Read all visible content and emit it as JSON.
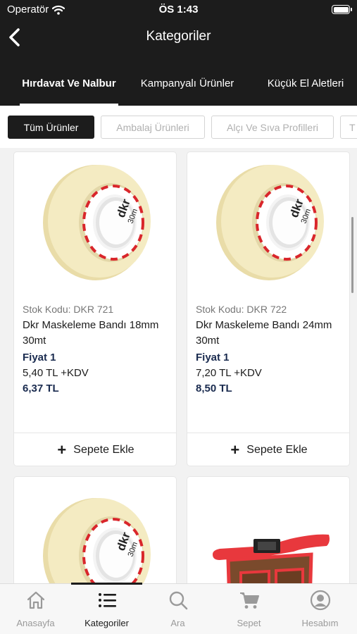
{
  "status_bar": {
    "carrier": "Operatör",
    "time": "ÖS 1:43"
  },
  "header": {
    "title": "Kategoriler"
  },
  "category_tabs": [
    {
      "label": "Hırdavat Ve Nalbur",
      "active": true
    },
    {
      "label": "Kampanyalı Ürünler",
      "active": false
    },
    {
      "label": "Küçük El Aletleri",
      "active": false
    }
  ],
  "filter_chips": [
    {
      "label": "Tüm Ürünler",
      "active": true
    },
    {
      "label": "Ambalaj Ürünleri",
      "active": false
    },
    {
      "label": "Alçı Ve Sıva Profilleri",
      "active": false
    },
    {
      "label": "T",
      "active": false
    }
  ],
  "products": [
    {
      "code": "Stok Kodu: DKR 721",
      "name": "Dkr Maskeleme Bandı 18mm 30mt",
      "price_label": "Fiyat 1",
      "price": "5,40 TL +KDV",
      "total": "6,37 TL",
      "add_label": "Sepete Ekle",
      "image": "tape-image"
    },
    {
      "code": "Stok Kodu: DKR 722",
      "name": "Dkr Maskeleme Bandı 24mm 30mt",
      "price_label": "Fiyat 1",
      "price": "7,20 TL +KDV",
      "total": "8,50 TL",
      "add_label": "Sepete Ekle",
      "image": "tape-image"
    },
    {
      "image": "tape-image"
    },
    {
      "image": "tool-belt-image"
    }
  ],
  "tape_brand": "dkr",
  "tape_length": "30m",
  "bottom_tabs": [
    {
      "label": "Anasayfa",
      "icon": "home-icon",
      "active": false
    },
    {
      "label": "Kategoriler",
      "icon": "list-icon",
      "active": true
    },
    {
      "label": "Ara",
      "icon": "search-icon",
      "active": false
    },
    {
      "label": "Sepet",
      "icon": "cart-icon",
      "active": false
    },
    {
      "label": "Hesabım",
      "icon": "account-icon",
      "active": false
    }
  ],
  "colors": {
    "header_bg": "#1c1c1c",
    "price_accent": "#1a2b4f",
    "tape": "#f2e8b8",
    "tape_red": "#d9262b",
    "belt_red": "#e8383d",
    "belt_brown": "#7a4a2c"
  }
}
